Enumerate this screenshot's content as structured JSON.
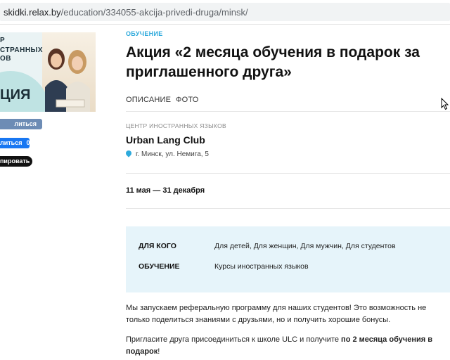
{
  "address_bar": {
    "host": "skidki.relax.by",
    "path": "/education/334055-akcija-privedi-druga/minsk/"
  },
  "promo_image": {
    "line1": "Р",
    "line2": "СТРАННЫХ",
    "line3": "ОВ",
    "big_text": "ЦИЯ"
  },
  "share": {
    "vk_label": "литься",
    "fb_label": "литься",
    "fb_count": "0",
    "copy_label": "пировать"
  },
  "article": {
    "category": "ОБУЧЕНИЕ",
    "title": "Акция «2 месяца обучения в подарок за приглашенного друга»",
    "tabs": [
      "ОПИСАНИЕ",
      "ФОТО"
    ],
    "org_category": "ЦЕНТР ИНОСТРАННЫХ ЯЗЫКОВ",
    "org_name": "Urban Lang Club",
    "address": "г. Минск, ул. Немига, 5",
    "dates": "11 мая — 31 декабря",
    "info": [
      {
        "label": "ДЛЯ КОГО",
        "value": "Для детей, Для женщин, Для мужчин, Для студентов"
      },
      {
        "label": "ОБУЧЕНИЕ",
        "value": "Курсы иностранных языков"
      }
    ],
    "para1": "Мы запускаем реферальную программу для наших студентов! Это возможность не только поделиться знаниями с друзьями, но и получить хорошие бонусы.",
    "para2_start": "Пригласите друга присоединиться к школе ULC и получите ",
    "para2_bold": "по 2 месяца обучения в подарок",
    "para2_end": "!"
  },
  "colors": {
    "accent": "#2eaadc",
    "info_bg": "#e6f4fa",
    "vk": "#6d8cb5",
    "fb": "#1877f2"
  }
}
